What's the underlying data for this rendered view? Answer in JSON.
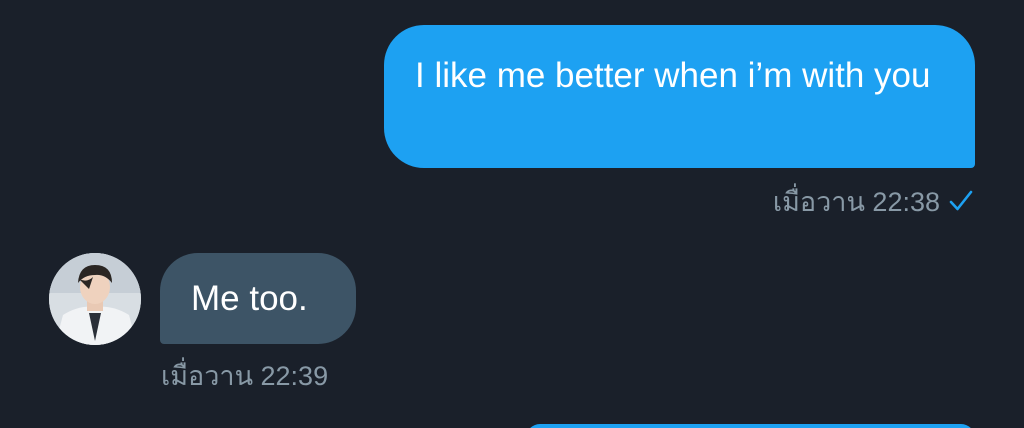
{
  "conversation": {
    "messages": [
      {
        "direction": "outgoing",
        "text": "I like me better when i’m with you",
        "time": "เมื่อวาน 22:38",
        "status_icon": "check-icon"
      },
      {
        "direction": "incoming",
        "text": "Me too.",
        "time": "เมื่อวาน 22:39",
        "sender_avatar": "avatar"
      }
    ]
  },
  "colors": {
    "background": "#1a202a",
    "outgoing_bubble": "#1da1f2",
    "incoming_bubble": "#3d5466",
    "meta_text": "#8899a6",
    "check": "#1da1f2"
  }
}
